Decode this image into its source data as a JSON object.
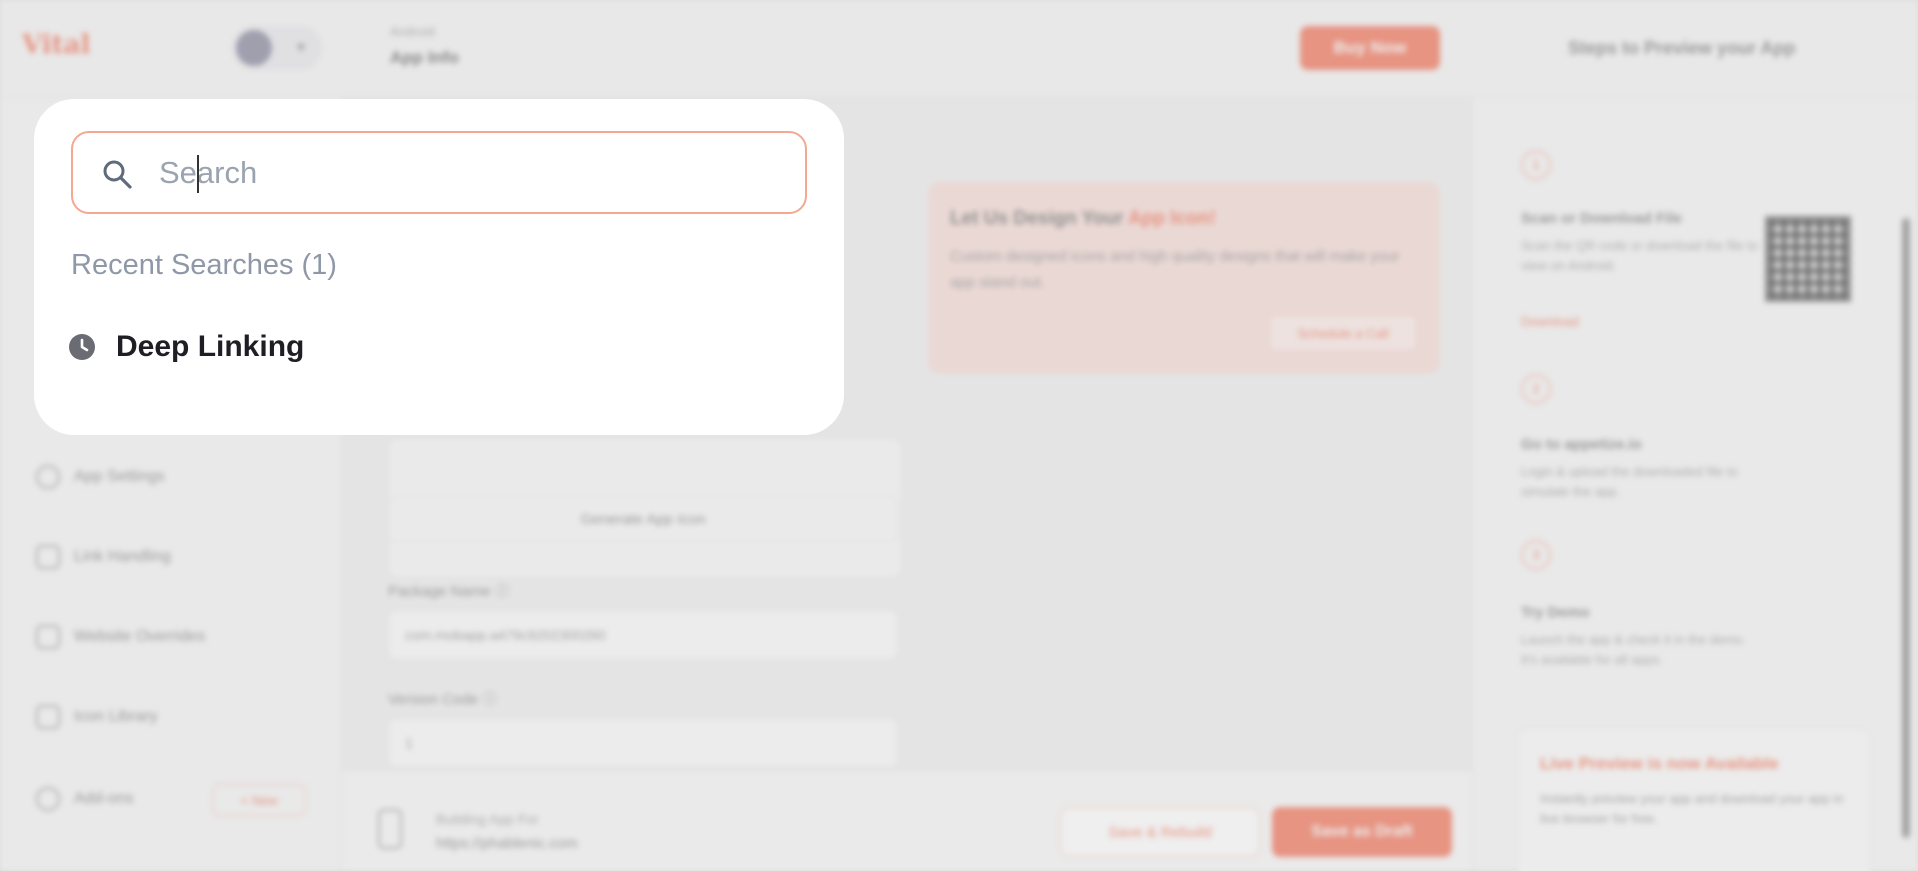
{
  "background": {
    "logo": "Vital",
    "header": {
      "crumb_small": "Android",
      "crumb_title": "App Info",
      "buy_button": "Buy Now",
      "preview_steps": "Steps to Preview your App"
    },
    "sidebar": {
      "items": [
        {
          "label": "App Settings",
          "icon": "gear-icon"
        },
        {
          "label": "Link Handling",
          "icon": "link-icon"
        },
        {
          "label": "Website Overrides",
          "icon": "monitor-icon"
        },
        {
          "label": "Icon Library",
          "icon": "grid-icon"
        },
        {
          "label": "Add-ons",
          "icon": "puzzle-icon"
        }
      ],
      "new_badge": "+ New"
    },
    "main": {
      "generate_icon_button": "Generate App Icon",
      "package_name_label": "Package Name ⓘ",
      "package_name_value": "com.mobapp.a479c9202300260",
      "version_code_label": "Version Code ⓘ",
      "version_code_value": "1",
      "promo": {
        "title_prefix": "Let Us Design Your",
        "title_highlight": "App Icon!",
        "text": "Custom designed icons and high quality designs that will make your app stand out.",
        "button": "Schedule a Call"
      },
      "bottom_bar": {
        "building_label": "Building App For",
        "building_url": "https://phablenic.com",
        "save_build_button": "Save & Rebuild",
        "save_draft_button": "Save as Draft"
      }
    },
    "right_panel": {
      "steps": [
        {
          "num": "1",
          "title": "Scan or Download File",
          "desc": "Scan the QR code or download the file to view on Android."
        },
        {
          "num": "2",
          "title": "Go to appetize.io",
          "desc": "Login & upload the downloaded file to simulate the app."
        },
        {
          "num": "3",
          "title": "Try Demo",
          "desc": "Launch the app & check it in the demo. It's available for all apps."
        }
      ],
      "download_link": "Download",
      "live_card": {
        "title": "Live Preview is now Available",
        "desc": "Instantly preview your app and download your app in live browser for free."
      }
    }
  },
  "search_panel": {
    "search": {
      "value": "",
      "placeholder": "Search",
      "icon": "search-icon"
    },
    "recent_heading": "Recent Searches (1)",
    "recent_items": [
      {
        "label": "Deep Linking",
        "icon": "clock-icon"
      }
    ]
  },
  "colors": {
    "accent": "#f05a3a",
    "search_border": "#f4a892",
    "muted_text": "#8f98a7",
    "overlay_bg": "#dcdcdc"
  }
}
